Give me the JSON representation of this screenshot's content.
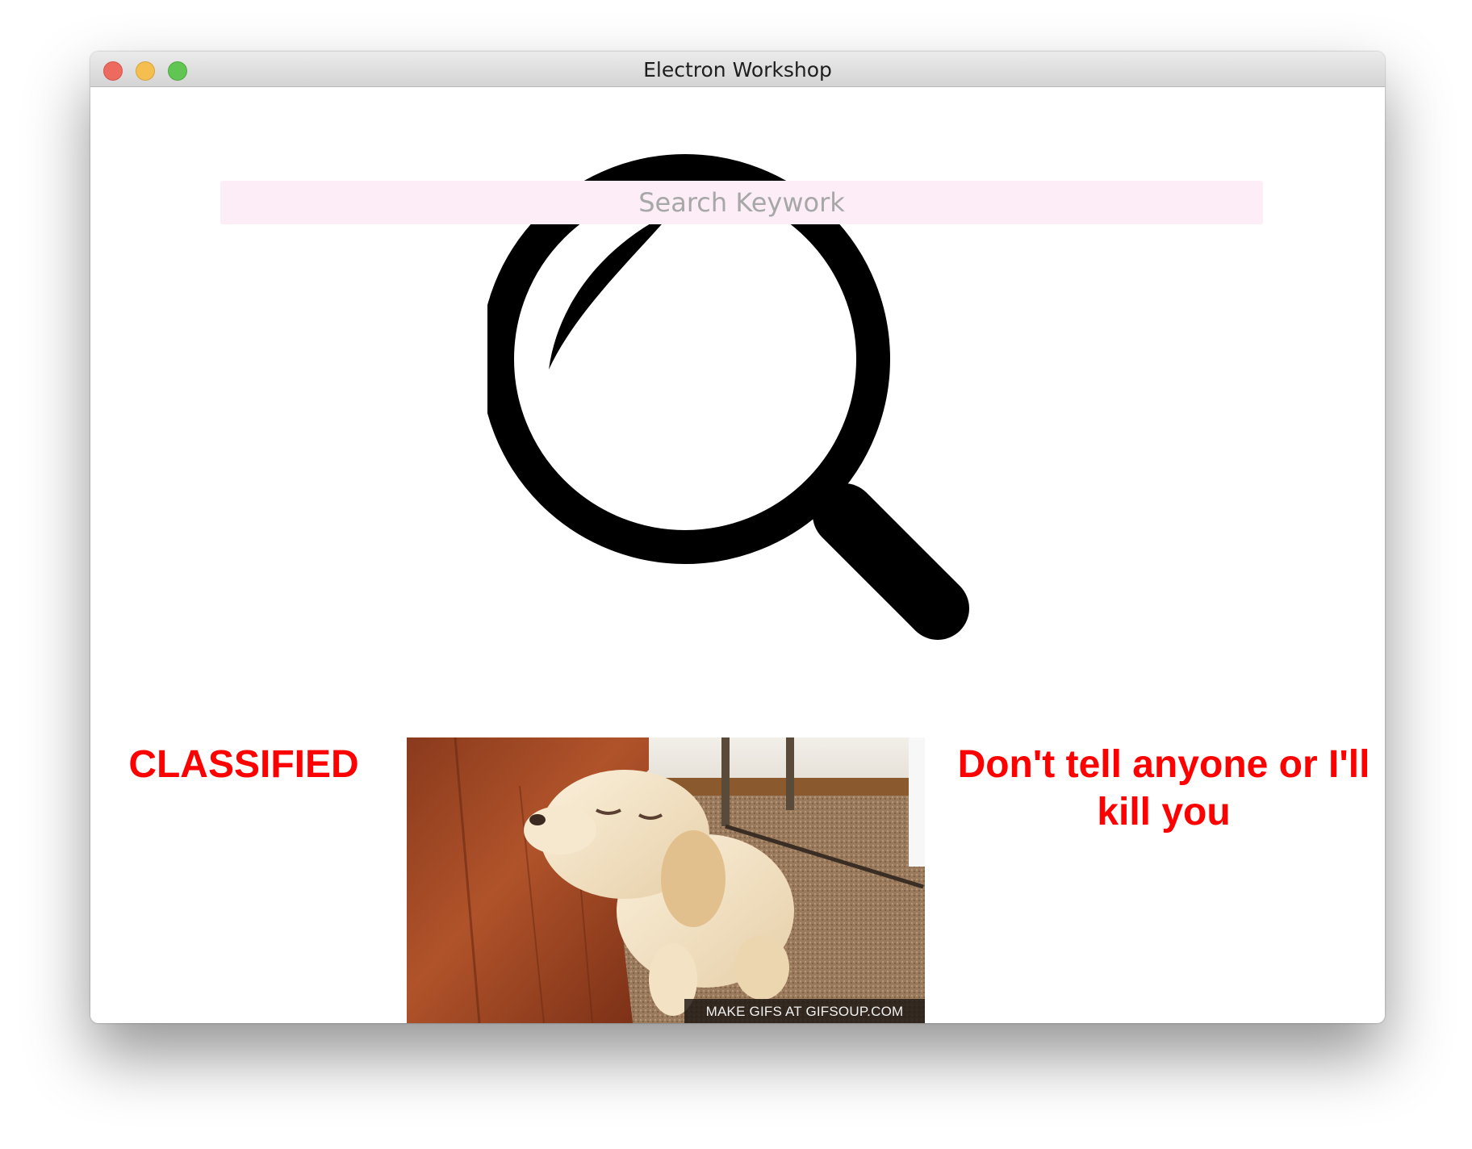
{
  "window": {
    "title": "Electron Workshop"
  },
  "search": {
    "placeholder": "Search Keywork",
    "value": ""
  },
  "main": {
    "left_text": "CLASSIFIED",
    "right_text": "Don't tell anyone or I'll kill you",
    "gif": {
      "alt": "puppy",
      "watermark": "MAKE GIFS AT GIFSOUP.COM"
    }
  },
  "icons": {
    "background": "magnifying-glass",
    "traffic_lights": [
      "close",
      "minimize",
      "zoom"
    ]
  },
  "colors": {
    "accent_text": "#ff0000",
    "search_bg": "#fcedf7",
    "close": "#ed6a5e",
    "minimize": "#f5bf4f",
    "zoom": "#61c554"
  }
}
